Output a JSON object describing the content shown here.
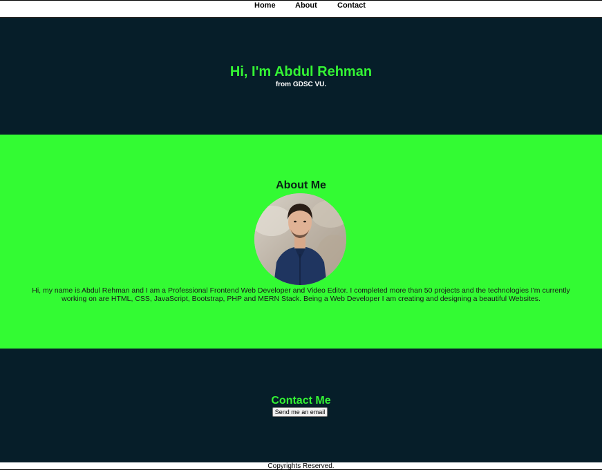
{
  "nav": {
    "home": "Home",
    "about": "About",
    "contact": "Contact"
  },
  "hero": {
    "title": "Hi, I'm Abdul Rehman",
    "subtitle": "from GDSC VU."
  },
  "about": {
    "title": "About Me",
    "text": "Hi, my name is Abdul Rehman and I am a Professional Frontend Web Developer and Video Editor. I completed more than 50 projects and the technologies I'm currently working on are HTML, CSS, JavaScript, Bootstrap, PHP and MERN Stack. Being a Web Developer I am creating and designing a beautiful Websites."
  },
  "contact": {
    "title": "Contact Me",
    "button_label": "Send me an email"
  },
  "footer": {
    "text": "Copyrights Reserved."
  },
  "colors": {
    "dark_background": "#061e29",
    "accent_green": "#34f434",
    "about_background": "#33fb33"
  }
}
